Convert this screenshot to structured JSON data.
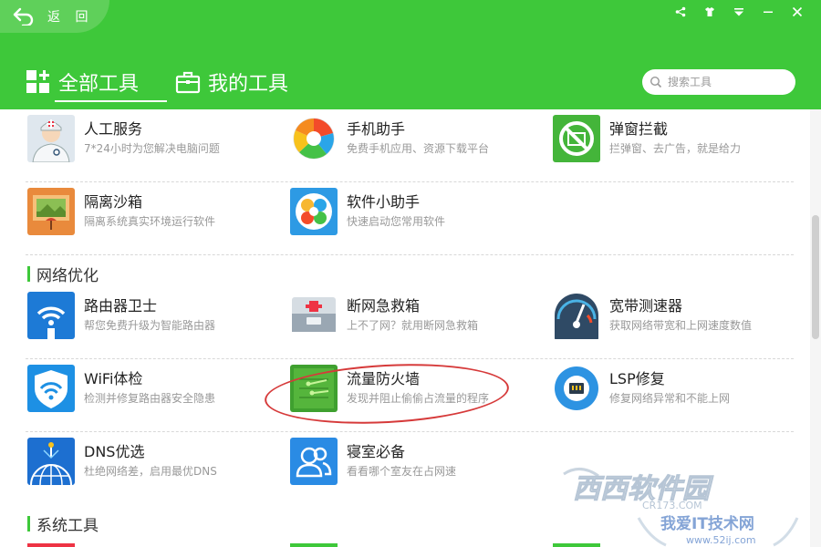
{
  "header": {
    "back_label": "返 回",
    "tabs": [
      {
        "label": "全部工具",
        "active": true
      },
      {
        "label": "我的工具",
        "active": false
      }
    ],
    "search": {
      "placeholder": "搜索工具",
      "value": ""
    },
    "window_controls": [
      "share-icon",
      "skin-icon",
      "menu-icon",
      "minimize-icon",
      "close-icon"
    ],
    "accent": "#3ec83a"
  },
  "rows": [
    [
      {
        "title": "人工服务",
        "desc": "7*24小时为您解决电脑问题",
        "icon": "customer-service-icon"
      },
      {
        "title": "手机助手",
        "desc": "免费手机应用、资源下载平台",
        "icon": "phone-assistant-icon"
      },
      {
        "title": "弹窗拦截",
        "desc": "拦弹窗、去广告，就是给力",
        "icon": "popup-block-icon"
      }
    ],
    [
      {
        "title": "隔离沙箱",
        "desc": "隔离系统真实环境运行软件",
        "icon": "sandbox-icon"
      },
      {
        "title": "软件小助手",
        "desc": "快速启动您常用软件",
        "icon": "software-helper-icon"
      }
    ]
  ],
  "sections": [
    {
      "label": "网络优化",
      "rows": [
        [
          {
            "title": "路由器卫士",
            "desc": "帮您免费升级为智能路由器",
            "icon": "router-guard-icon"
          },
          {
            "title": "断网急救箱",
            "desc": "上不了网？就用断网急救箱",
            "icon": "first-aid-kit-icon"
          },
          {
            "title": "宽带测速器",
            "desc": "获取网络带宽和上网速度数值",
            "icon": "speedometer-icon"
          }
        ],
        [
          {
            "title": "WiFi体检",
            "desc": "检测并修复路由器安全隐患",
            "icon": "wifi-check-icon"
          },
          {
            "title": "流量防火墙",
            "desc": "发现并阻止偷偷占流量的程序",
            "icon": "traffic-firewall-icon"
          },
          {
            "title": "LSP修复",
            "desc": "修复网络异常和不能上网",
            "icon": "lsp-repair-icon"
          }
        ],
        [
          {
            "title": "DNS优选",
            "desc": "杜绝网络差，启用最优DNS",
            "icon": "dns-globe-icon"
          },
          {
            "title": "寝室必备",
            "desc": "看看哪个室友在占网速",
            "icon": "dorm-users-icon"
          }
        ]
      ]
    },
    {
      "label": "系统工具",
      "rows": []
    }
  ],
  "watermark": {
    "brand": "西西软件园",
    "brand_url": "CR173.COM",
    "site": "我爱IT技术网",
    "site_url": "www.52ij.com"
  }
}
